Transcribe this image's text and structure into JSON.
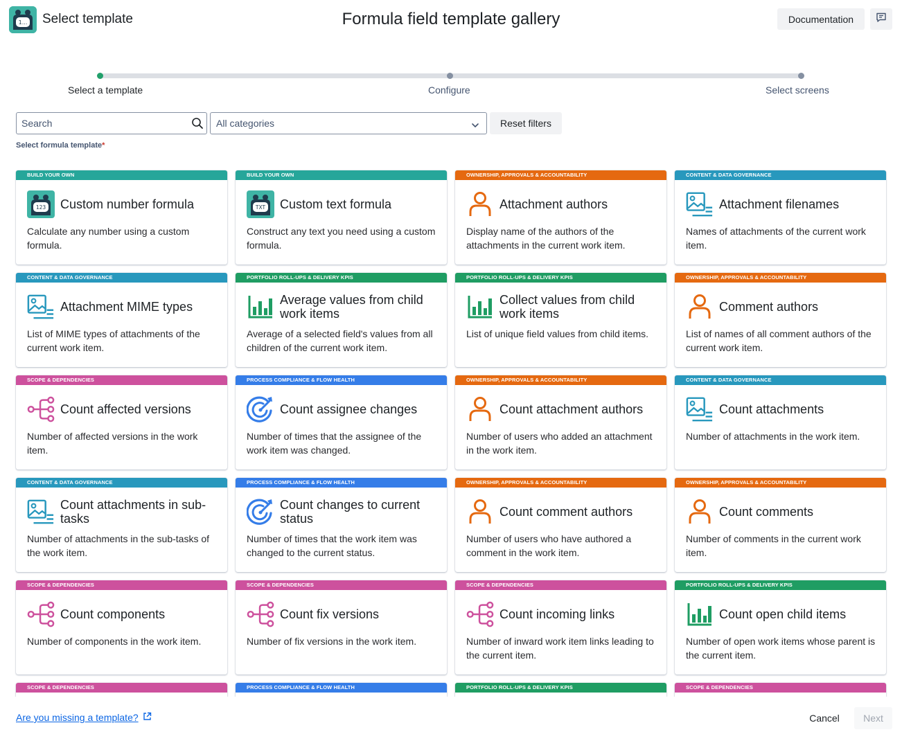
{
  "header": {
    "app_title": "Select template",
    "page_title": "Formula field template gallery",
    "documentation_label": "Documentation",
    "logo_icon": "robot-logo-icon",
    "feedback_icon": "feedback-icon"
  },
  "stepper": {
    "steps": [
      {
        "label": "Select a template",
        "state": "active"
      },
      {
        "label": "Configure",
        "state": "pending"
      },
      {
        "label": "Select screens",
        "state": "pending"
      }
    ]
  },
  "filters": {
    "search_placeholder": "Search",
    "category_value": "All categories",
    "reset_label": "Reset filters",
    "field_label": "Select formula template",
    "required_mark": "*"
  },
  "colors": {
    "teal": "#26a69a",
    "orange": "#e56910",
    "blue_gov": "#2898bd",
    "green": "#1f9d63",
    "pink": "#cd519d",
    "blue_proc": "#357de8"
  },
  "cards": [
    {
      "category": "BUILD YOUR OWN",
      "color": "#26a69a",
      "icon": "robot-number-icon",
      "title": "Custom number formula",
      "description": "Calculate any number using a custom formula."
    },
    {
      "category": "BUILD YOUR OWN",
      "color": "#26a69a",
      "icon": "robot-text-icon",
      "title": "Custom text formula",
      "description": "Construct any text you need using a custom formula."
    },
    {
      "category": "OWNERSHIP, APPROVALS & ACCOUNTABILITY",
      "color": "#e56910",
      "icon": "person-icon",
      "title": "Attachment authors",
      "description": "Display name of the authors of the attachments in the current work item."
    },
    {
      "category": "CONTENT & DATA GOVERNANCE",
      "color": "#2898bd",
      "icon": "image-list-icon",
      "title": "Attachment filenames",
      "description": "Names of attachments of the current work item."
    },
    {
      "category": "CONTENT & DATA GOVERNANCE",
      "color": "#2898bd",
      "icon": "image-list-icon",
      "title": "Attachment MIME types",
      "description": "List of MIME types of attachments of the current work item."
    },
    {
      "category": "PORTFOLIO ROLL-UPS & DELIVERY KPIS",
      "color": "#1f9d63",
      "icon": "bar-chart-icon",
      "title": "Average values from child work items",
      "description": "Average of a selected field's values from all children of the current work item."
    },
    {
      "category": "PORTFOLIO ROLL-UPS & DELIVERY KPIS",
      "color": "#1f9d63",
      "icon": "bar-chart-icon",
      "title": "Collect values from child work items",
      "description": "List of unique field values from child items."
    },
    {
      "category": "OWNERSHIP, APPROVALS & ACCOUNTABILITY",
      "color": "#e56910",
      "icon": "person-icon",
      "title": "Comment authors",
      "description": "List of names of all comment authors of the current work item."
    },
    {
      "category": "SCOPE & DEPENDENCIES",
      "color": "#cd519d",
      "icon": "hierarchy-icon",
      "title": "Count affected versions",
      "description": "Number of affected versions in the work item."
    },
    {
      "category": "PROCESS COMPLIANCE & FLOW HEALTH",
      "color": "#357de8",
      "icon": "target-icon",
      "title": "Count assignee changes",
      "description": "Number of times that the assignee of the work item was changed."
    },
    {
      "category": "OWNERSHIP, APPROVALS & ACCOUNTABILITY",
      "color": "#e56910",
      "icon": "person-icon",
      "title": "Count attachment authors",
      "description": "Number of users who added an attachment in the work item."
    },
    {
      "category": "CONTENT & DATA GOVERNANCE",
      "color": "#2898bd",
      "icon": "image-list-icon",
      "title": "Count attachments",
      "description": "Number of attachments in the work item."
    },
    {
      "category": "CONTENT & DATA GOVERNANCE",
      "color": "#2898bd",
      "icon": "image-list-icon",
      "title": "Count attachments in sub-tasks",
      "description": "Number of attachments in the sub-tasks of the work item."
    },
    {
      "category": "PROCESS COMPLIANCE & FLOW HEALTH",
      "color": "#357de8",
      "icon": "target-icon",
      "title": "Count changes to current status",
      "description": "Number of times that the work item was changed to the current status."
    },
    {
      "category": "OWNERSHIP, APPROVALS & ACCOUNTABILITY",
      "color": "#e56910",
      "icon": "person-icon",
      "title": "Count comment authors",
      "description": "Number of users who have authored a comment in the work item."
    },
    {
      "category": "OWNERSHIP, APPROVALS & ACCOUNTABILITY",
      "color": "#e56910",
      "icon": "person-icon",
      "title": "Count comments",
      "description": "Number of comments in the current work item."
    },
    {
      "category": "SCOPE & DEPENDENCIES",
      "color": "#cd519d",
      "icon": "hierarchy-icon",
      "title": "Count components",
      "description": "Number of components in the work item."
    },
    {
      "category": "SCOPE & DEPENDENCIES",
      "color": "#cd519d",
      "icon": "hierarchy-icon",
      "title": "Count fix versions",
      "description": "Number of fix versions in the work item."
    },
    {
      "category": "SCOPE & DEPENDENCIES",
      "color": "#cd519d",
      "icon": "hierarchy-icon",
      "title": "Count incoming links",
      "description": "Number of inward work item links leading to the current item."
    },
    {
      "category": "PORTFOLIO ROLL-UPS & DELIVERY KPIS",
      "color": "#1f9d63",
      "icon": "bar-chart-icon",
      "title": "Count open child items",
      "description": "Number of open work items whose parent is the current item."
    },
    {
      "category": "SCOPE & DEPENDENCIES",
      "color": "#cd519d",
      "icon": "",
      "title": "",
      "description": ""
    },
    {
      "category": "PROCESS COMPLIANCE & FLOW HEALTH",
      "color": "#357de8",
      "icon": "",
      "title": "",
      "description": ""
    },
    {
      "category": "PORTFOLIO ROLL-UPS & DELIVERY KPIS",
      "color": "#1f9d63",
      "icon": "",
      "title": "",
      "description": ""
    },
    {
      "category": "SCOPE & DEPENDENCIES",
      "color": "#cd519d",
      "icon": "",
      "title": "",
      "description": ""
    }
  ],
  "footer": {
    "missing_link": "Are you missing a template?",
    "cancel_label": "Cancel",
    "next_label": "Next"
  }
}
